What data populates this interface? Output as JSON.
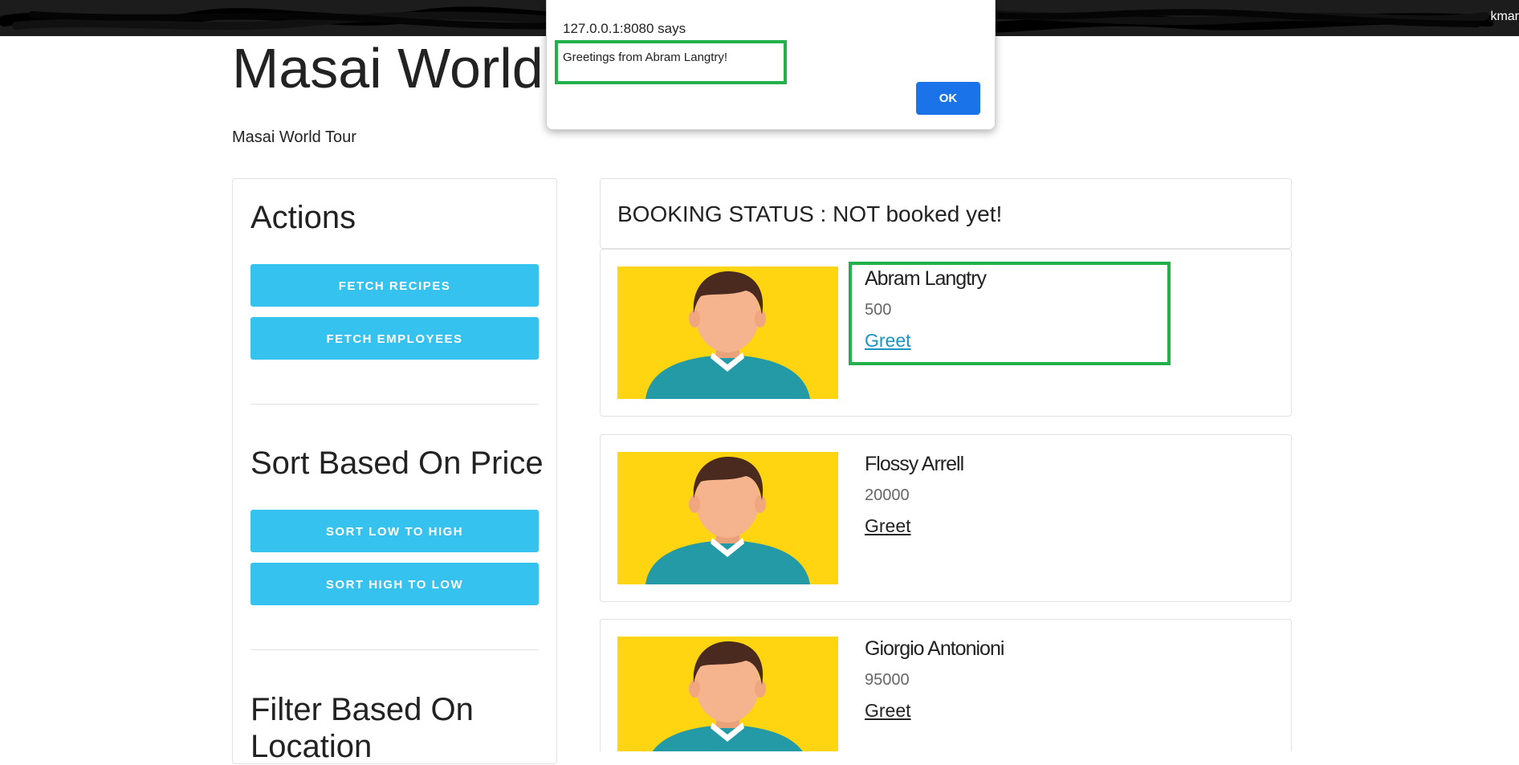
{
  "topbar": {
    "user_fragment": "kmar"
  },
  "page": {
    "title": "Masai World T",
    "subtitle": "Masai World Tour"
  },
  "sidebar": {
    "actions_heading": "Actions",
    "fetch_recipes_label": "FETCH RECIPES",
    "fetch_employees_label": "FETCH EMPLOYEES",
    "sort_heading": "Sort Based On Price",
    "sort_low_high_label": "SORT LOW TO HIGH",
    "sort_high_low_label": "SORT HIGH TO LOW",
    "filter_heading": "Filter Based On Location"
  },
  "booking": {
    "status_text": "BOOKING STATUS : NOT booked yet!"
  },
  "employees": [
    {
      "name": "Abram Langtry",
      "price": "500",
      "greet_label": "Greet"
    },
    {
      "name": "Flossy Arrell",
      "price": "20000",
      "greet_label": "Greet"
    },
    {
      "name": "Giorgio Antonioni",
      "price": "95000",
      "greet_label": "Greet"
    }
  ],
  "dialog": {
    "origin": "127.0.0.1:8080 says",
    "message": "Greetings from Abram Langtry!",
    "ok_label": "OK"
  },
  "colors": {
    "accent_button": "#36c2ee",
    "dialog_button": "#1a73e8",
    "highlight": "#22b04b",
    "avatar_background": "#fed510"
  }
}
